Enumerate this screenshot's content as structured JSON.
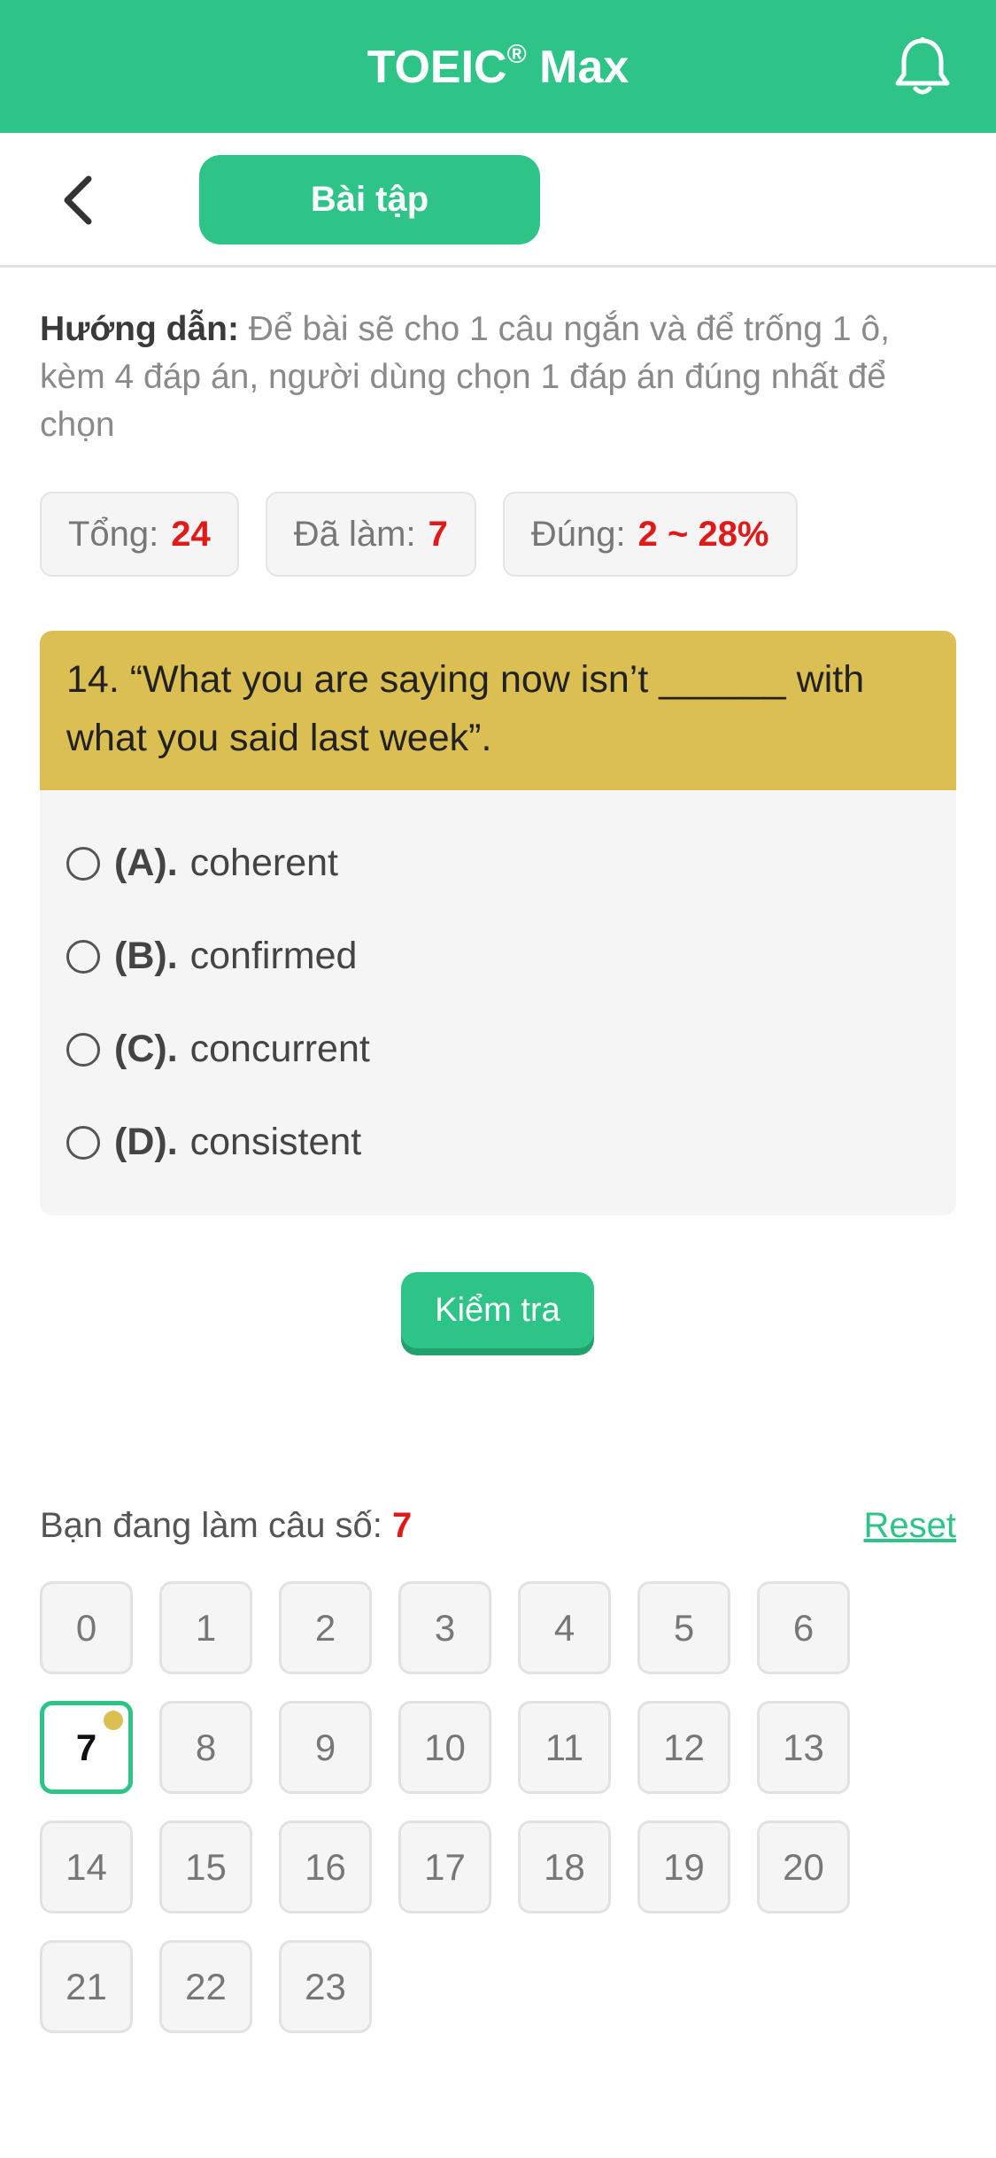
{
  "header": {
    "title": "TOEIC",
    "title_mark": "®",
    "title_suffix": " Max",
    "bell_icon": "bell-icon"
  },
  "subbar": {
    "back_icon": "chevron-left-icon",
    "tab_label": "Bài tập"
  },
  "instructions": {
    "label": "Hướng dẫn:",
    "text": " Để bài sẽ cho 1 câu ngắn và để trống 1 ô, kèm 4 đáp án, người dùng chọn 1 đáp án đúng nhất để chọn"
  },
  "stats": [
    {
      "label": "Tổng:",
      "value": "24"
    },
    {
      "label": "Đã làm:",
      "value": "7"
    },
    {
      "label": "Đúng:",
      "value": "2 ~ 28%"
    }
  ],
  "question": {
    "text": "14. “What you are saying now isn’t ______ with what you said last week”.",
    "options": [
      {
        "letter": "(A).",
        "text": "coherent"
      },
      {
        "letter": "(B).",
        "text": "confirmed"
      },
      {
        "letter": "(C).",
        "text": "concurrent"
      },
      {
        "letter": "(D).",
        "text": "consistent"
      }
    ]
  },
  "check_button": "Kiểm tra",
  "progress": {
    "label": "Bạn đang làm câu số:",
    "current": "7",
    "reset_label": "Reset",
    "numbers": [
      "0",
      "1",
      "2",
      "3",
      "4",
      "5",
      "6",
      "7",
      "8",
      "9",
      "10",
      "11",
      "12",
      "13",
      "14",
      "15",
      "16",
      "17",
      "18",
      "19",
      "20",
      "21",
      "22",
      "23"
    ],
    "active_index": 7
  },
  "colors": {
    "accent": "#2ec488",
    "question_bg": "#dcbf53",
    "highlight_red": "#e01919"
  }
}
